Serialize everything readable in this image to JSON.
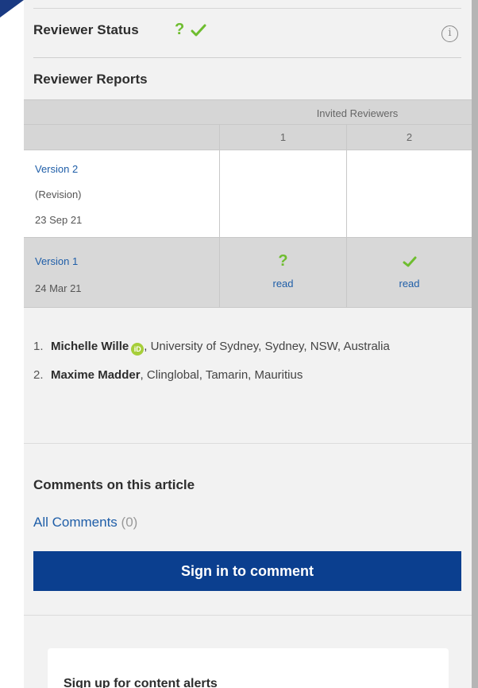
{
  "reviewer_status": {
    "label": "Reviewer Status",
    "question_mark": "?",
    "info_symbol": "i"
  },
  "reports": {
    "title": "Reviewer Reports",
    "invited_header": "Invited Reviewers",
    "columns": [
      "1",
      "2"
    ],
    "rows": [
      {
        "version": "Version 2",
        "note": "(Revision)",
        "date": "23 Sep 21",
        "marks": [
          "",
          ""
        ]
      },
      {
        "version": "Version 1",
        "date": "24 Mar 21",
        "marks": [
          {
            "icon": "question-icon",
            "symbol": "?",
            "link": "read"
          },
          {
            "icon": "checkmark-icon",
            "link": "read"
          }
        ]
      }
    ]
  },
  "reviewers": [
    {
      "num": "1.",
      "name": "Michelle Wille",
      "orcid": "iD",
      "affiliation": ", University of Sydney, Sydney, NSW, Australia"
    },
    {
      "num": "2.",
      "name": "Maxime Madder",
      "affiliation": ", Clinglobal, Tamarin, Mauritius"
    }
  ],
  "comments": {
    "title": "Comments on this article",
    "all_label": "All Comments",
    "count": "(0)",
    "signin_label": "Sign in to comment"
  },
  "alerts": {
    "title": "Sign up for content alerts"
  },
  "colors": {
    "link": "#1f5ea8",
    "button": "#0b3f8f",
    "approved": "#6ebd2f",
    "panel": "#f2f2f2"
  }
}
